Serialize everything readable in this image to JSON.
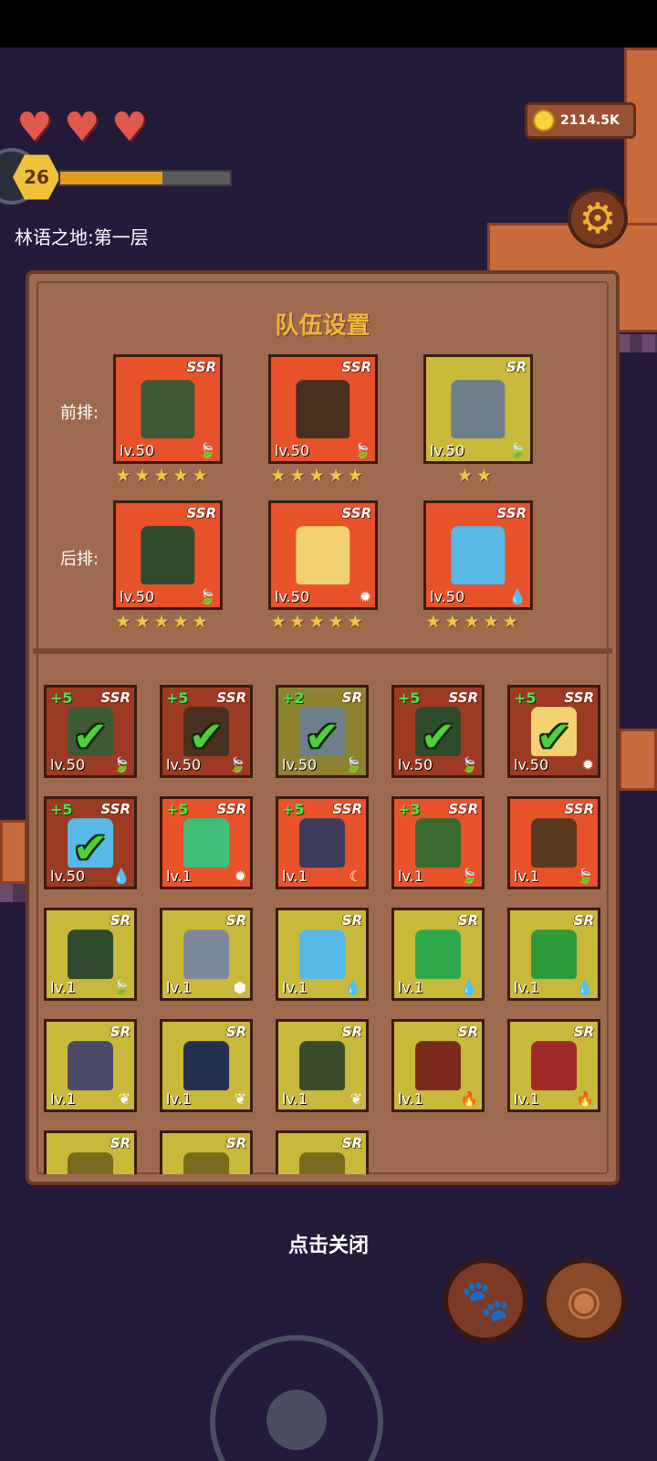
{
  "hud": {
    "hearts": 3,
    "player_level": "26",
    "xp_progress": 0.6,
    "area_name": "林语之地:第一层",
    "coins": "2114.5K"
  },
  "panel": {
    "title": "队伍设置",
    "front_label": "前排:",
    "back_label": "后排:"
  },
  "team": {
    "front": [
      {
        "rarity": "SSR",
        "level": "lv.50",
        "element": "leaf",
        "stars": 5,
        "sprite": "orc-knight"
      },
      {
        "rarity": "SSR",
        "level": "lv.50",
        "element": "leaf",
        "stars": 5,
        "sprite": "treant"
      },
      {
        "rarity": "SR",
        "level": "lv.50",
        "element": "leaf",
        "stars": 2,
        "sprite": "goblin-wolf-rider"
      }
    ],
    "back": [
      {
        "rarity": "SSR",
        "level": "lv.50",
        "element": "leaf",
        "stars": 5,
        "sprite": "orc-shaman"
      },
      {
        "rarity": "SSR",
        "level": "lv.50",
        "element": "sun",
        "stars": 5,
        "sprite": "fairy"
      },
      {
        "rarity": "SSR",
        "level": "lv.50",
        "element": "water",
        "stars": 5,
        "sprite": "water-spirit"
      }
    ]
  },
  "roster": [
    {
      "rarity": "SSR",
      "plus": "+5",
      "level": "lv.50",
      "element": "leaf",
      "owned": true,
      "sprite": "orc-knight"
    },
    {
      "rarity": "SSR",
      "plus": "+5",
      "level": "lv.50",
      "element": "leaf",
      "owned": true,
      "sprite": "treant"
    },
    {
      "rarity": "SR",
      "plus": "+2",
      "level": "lv.50",
      "element": "leaf",
      "owned": true,
      "sprite": "goblin-wolf-rider"
    },
    {
      "rarity": "SSR",
      "plus": "+5",
      "level": "lv.50",
      "element": "leaf",
      "owned": true,
      "sprite": "orc-shaman"
    },
    {
      "rarity": "SSR",
      "plus": "+5",
      "level": "lv.50",
      "element": "sun",
      "owned": true,
      "sprite": "fairy"
    },
    {
      "rarity": "SSR",
      "plus": "+5",
      "level": "lv.50",
      "element": "water",
      "owned": true,
      "sprite": "water-spirit"
    },
    {
      "rarity": "SSR",
      "plus": "+5",
      "level": "lv.1",
      "element": "sun",
      "owned": false,
      "sprite": "green-ghoul"
    },
    {
      "rarity": "SSR",
      "plus": "+5",
      "level": "lv.1",
      "element": "moon",
      "owned": false,
      "sprite": "reaper"
    },
    {
      "rarity": "SSR",
      "plus": "+3",
      "level": "lv.1",
      "element": "leaf",
      "owned": false,
      "sprite": "goblin-axes"
    },
    {
      "rarity": "SSR",
      "plus": "",
      "level": "lv.1",
      "element": "leaf",
      "owned": false,
      "sprite": "tree-stump"
    },
    {
      "rarity": "SR",
      "plus": "",
      "level": "lv.1",
      "element": "leaf",
      "owned": false,
      "sprite": "orc-shaman"
    },
    {
      "rarity": "SR",
      "plus": "",
      "level": "lv.1",
      "element": "earth",
      "owned": false,
      "sprite": "stone-golem"
    },
    {
      "rarity": "SR",
      "plus": "",
      "level": "lv.1",
      "element": "water",
      "owned": false,
      "sprite": "water-spirit"
    },
    {
      "rarity": "SR",
      "plus": "",
      "level": "lv.1",
      "element": "water",
      "owned": false,
      "sprite": "green-slime"
    },
    {
      "rarity": "SR",
      "plus": "",
      "level": "lv.1",
      "element": "water",
      "owned": false,
      "sprite": "green-ogre"
    },
    {
      "rarity": "SR",
      "plus": "",
      "level": "lv.1",
      "element": "wind",
      "owned": false,
      "sprite": "bat"
    },
    {
      "rarity": "SR",
      "plus": "",
      "level": "lv.1",
      "element": "wind",
      "owned": false,
      "sprite": "eye-mage"
    },
    {
      "rarity": "SR",
      "plus": "",
      "level": "lv.1",
      "element": "wind",
      "owned": false,
      "sprite": "goblin-archer"
    },
    {
      "rarity": "SR",
      "plus": "",
      "level": "lv.1",
      "element": "fire",
      "owned": false,
      "sprite": "samurai"
    },
    {
      "rarity": "SR",
      "plus": "",
      "level": "lv.1",
      "element": "fire",
      "owned": false,
      "sprite": "red-demon"
    },
    {
      "rarity": "SR",
      "plus": "",
      "level": "",
      "element": "",
      "owned": false,
      "sprite": "partial"
    },
    {
      "rarity": "SR",
      "plus": "",
      "level": "",
      "element": "",
      "owned": false,
      "sprite": "partial"
    },
    {
      "rarity": "SR",
      "plus": "",
      "level": "",
      "element": "",
      "owned": false,
      "sprite": "partial"
    }
  ],
  "close_hint": "点击关闭",
  "buttons": {
    "pet": "paw-icon",
    "bag": "leather-bag-icon"
  },
  "icons": {
    "leaf": "🍃",
    "sun": "✹",
    "water": "💧",
    "moon": "☾",
    "earth": "⬢",
    "wind": "❦",
    "fire": "🔥"
  },
  "sprite_colors": {
    "orc-knight": "#3d5a34",
    "treant": "#4a3020",
    "goblin-wolf-rider": "#6c7f8a",
    "orc-shaman": "#2f4a2c",
    "fairy": "#f2d270",
    "water-spirit": "#58b8e6",
    "green-ghoul": "#3fc07a",
    "reaper": "#3c3c5c",
    "goblin-axes": "#3a6a2e",
    "tree-stump": "#5a3a20",
    "stone-golem": "#7e8a9c",
    "green-slime": "#2fa84a",
    "green-ogre": "#2f9a3a",
    "bat": "#4a4a6a",
    "eye-mage": "#243050",
    "goblin-archer": "#3a4a2a",
    "samurai": "#7a2a1a",
    "red-demon": "#a02a2a",
    "partial": "#7a6a20"
  }
}
